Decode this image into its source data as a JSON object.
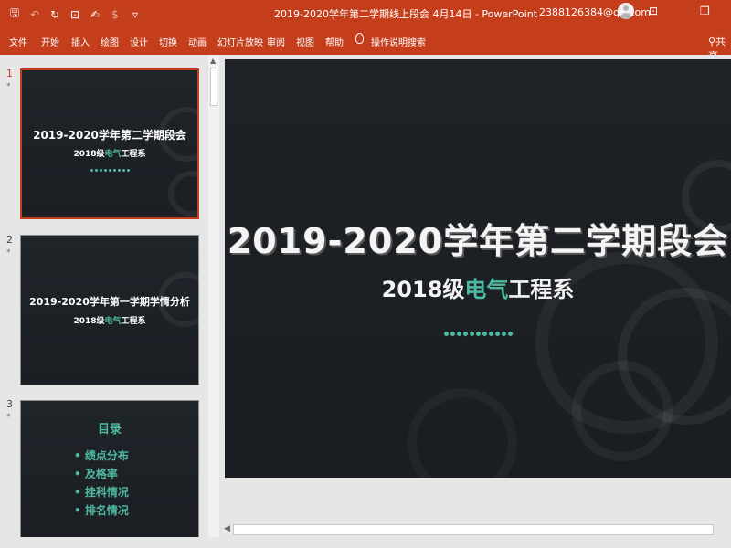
{
  "window": {
    "title": "2019-2020学年第二学期线上段会  4月14日  -  PowerPoint",
    "account": "2388126384@qq.com"
  },
  "quick_access": {
    "save": "🖫",
    "undo": "↶",
    "redo": "↻",
    "touch": "✍",
    "currency": "$",
    "more": "▿"
  },
  "window_controls": {
    "ribbon_display": "⊡",
    "restore": "❐"
  },
  "ribbon": {
    "tabs": [
      "文件",
      "开始",
      "插入",
      "绘图",
      "设计",
      "切换",
      "动画",
      "幻灯片放映",
      "审阅",
      "视图",
      "帮助"
    ],
    "tell_me": "操作说明搜索",
    "share": "共享"
  },
  "thumbnails": [
    {
      "number": "1",
      "marker": "*",
      "title": "2019-2020学年第二学期段会",
      "subtitle_pre": "2018级",
      "subtitle_accent": "电气",
      "subtitle_post": "工程系"
    },
    {
      "number": "2",
      "marker": "*",
      "title": "2019-2020学年第一学期学情分析",
      "subtitle_pre": "2018级",
      "subtitle_accent": "电气",
      "subtitle_post": "工程系"
    },
    {
      "number": "3",
      "marker": "*",
      "toc_title": "目录",
      "toc_items": [
        "绩点分布",
        "及格率",
        "挂科情况",
        "排名情况"
      ]
    }
  ],
  "slide": {
    "title": "2019-2020学年第二学期段会",
    "subtitle_pre": "2018级",
    "subtitle_accent": "电气",
    "subtitle_post": "工程系"
  },
  "colors": {
    "ribbon": "#c43e1c",
    "slide_bg": "#1e2227",
    "accent": "#4fb99f"
  }
}
